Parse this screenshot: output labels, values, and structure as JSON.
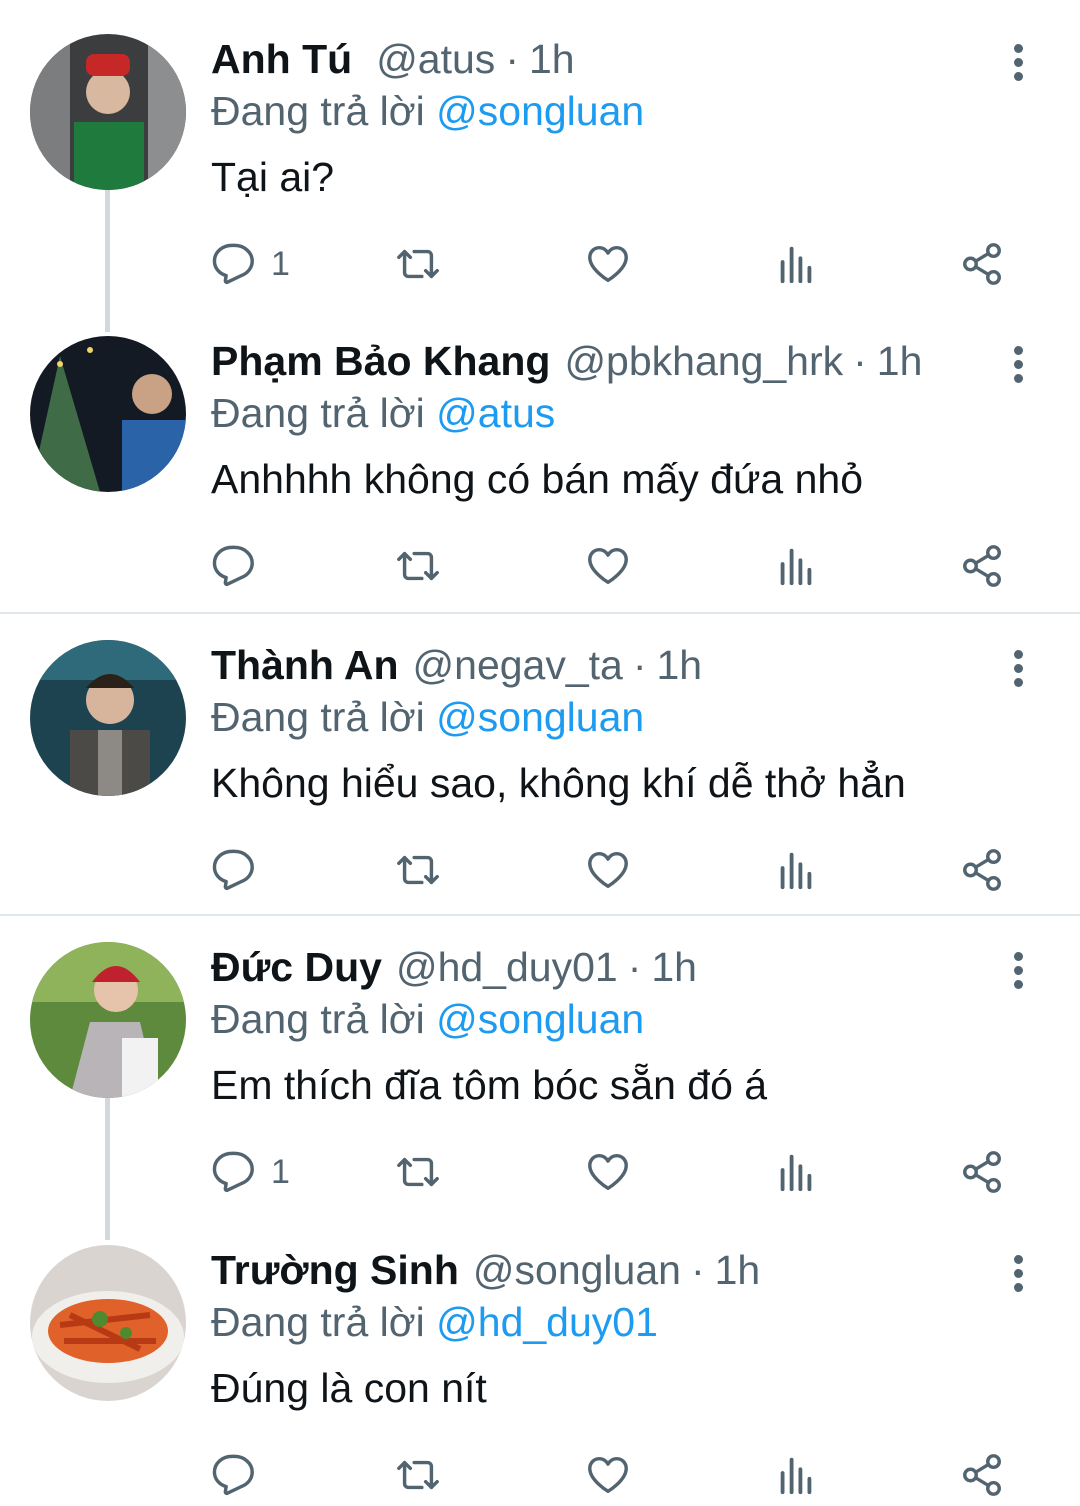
{
  "reply_prefix": "Đang trả lời",
  "colors": {
    "mention": "#1d9bf0",
    "muted": "#536471",
    "divider": "#e1e8ed",
    "thread_line": "#cfd9de"
  },
  "icons": [
    "reply-icon",
    "retweet-icon",
    "like-icon",
    "views-icon",
    "share-icon",
    "more-icon"
  ],
  "tweets": [
    {
      "name": "Anh Tú",
      "handle": "@atus",
      "dot": "·",
      "time": "1h",
      "replying_to": "@songluan",
      "text": "Tại ai?",
      "reply_count": "1"
    },
    {
      "name": "Phạm Bảo Khang",
      "handle": "@pbkhang_hrk",
      "dot": "·",
      "time": "1h",
      "replying_to": "@atus",
      "text": "Anhhhh không có bán mấy đứa nhỏ",
      "reply_count": ""
    },
    {
      "name": "Thành An",
      "handle": "@negav_ta",
      "dot": "·",
      "time": "1h",
      "replying_to": "@songluan",
      "text": "Không hiểu sao, không khí dễ thở hẳn",
      "reply_count": ""
    },
    {
      "name": "Đức Duy",
      "handle": "@hd_duy01",
      "dot": "·",
      "time": "1h",
      "replying_to": "@songluan",
      "text": "Em thích đĩa tôm bóc sẵn đó á",
      "reply_count": "1"
    },
    {
      "name": "Trường Sinh",
      "handle": "@songluan",
      "dot": "·",
      "time": "1h",
      "replying_to": "@hd_duy01",
      "text": "Đúng là con nít",
      "reply_count": ""
    }
  ]
}
